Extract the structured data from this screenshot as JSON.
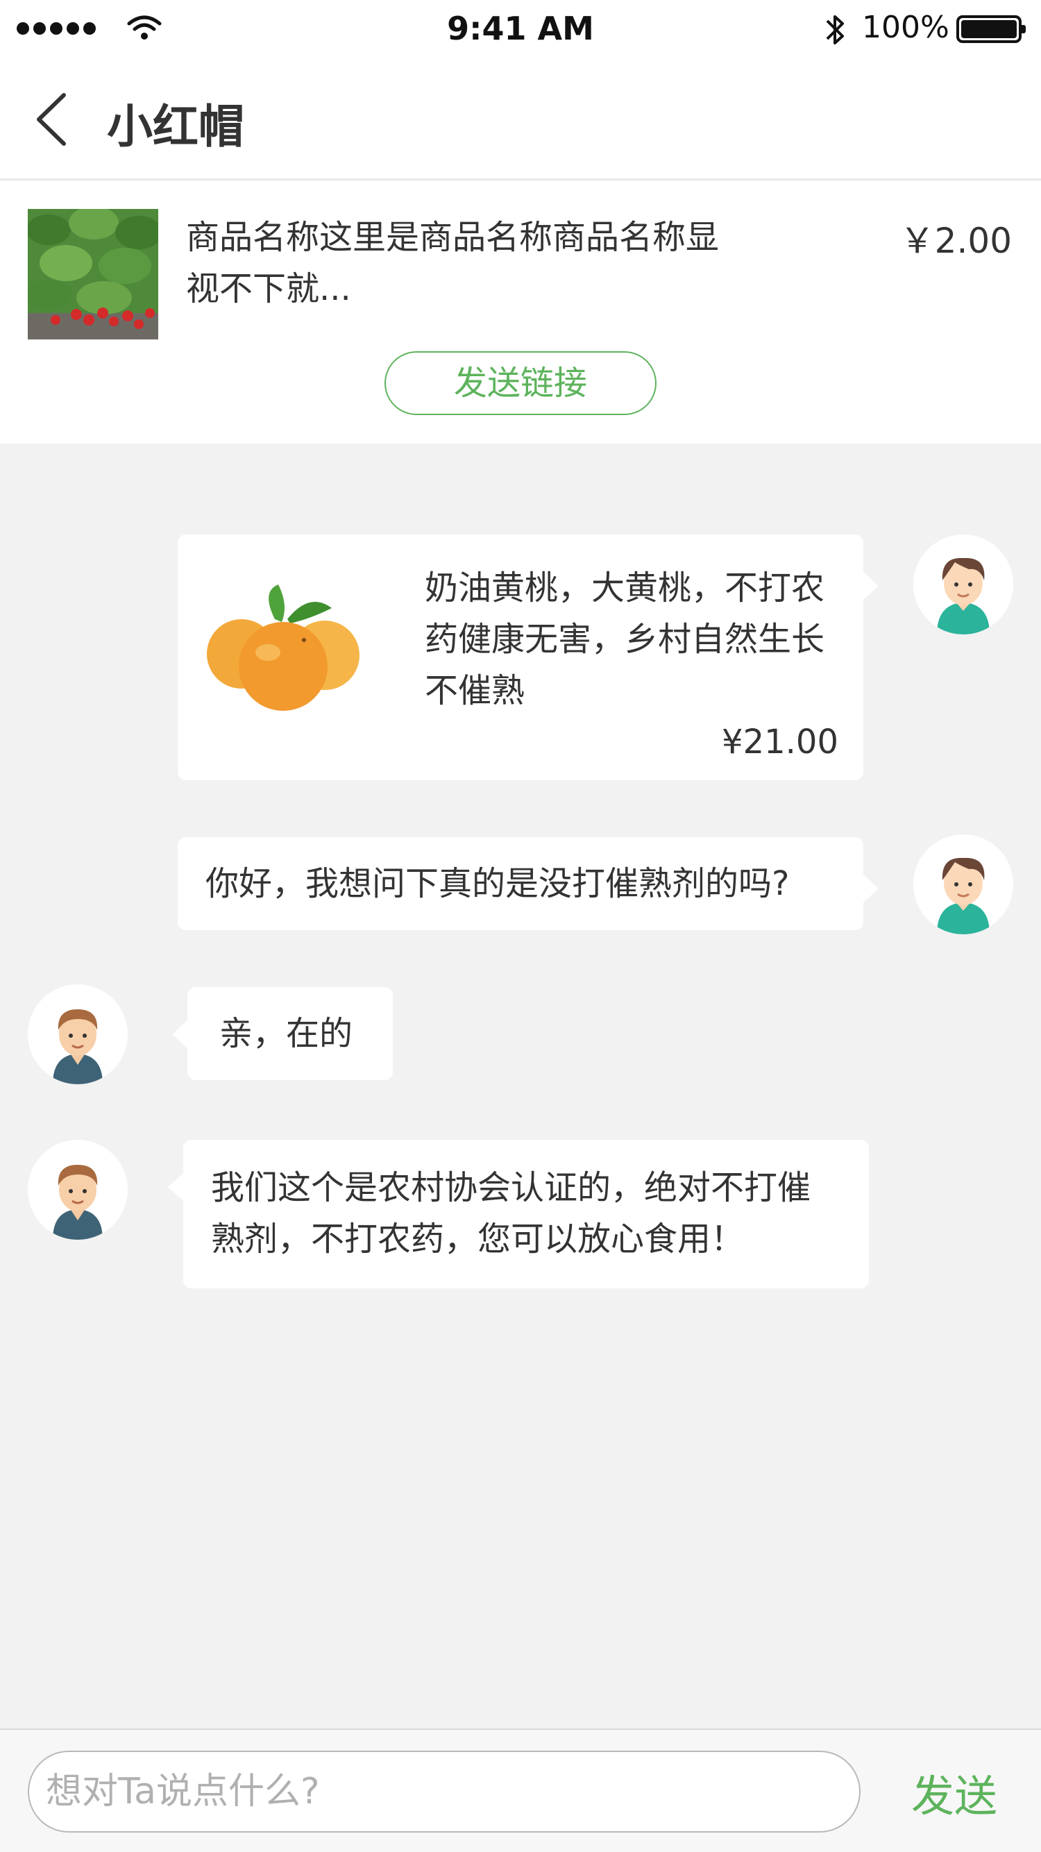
{
  "status_bar": {
    "time": "9:41 AM",
    "battery": "100%",
    "icons": [
      "signal-dots-icon",
      "wifi-icon",
      "bluetooth-icon",
      "battery-icon"
    ]
  },
  "nav": {
    "back_icon": "chevron-left-icon",
    "title": "小红帽"
  },
  "product": {
    "name": "商品名称这里是商品名称商品名称显视不下就...",
    "price": "￥2.00",
    "send_link_label": "发送链接"
  },
  "messages": [
    {
      "side": "right",
      "type": "product",
      "text": "奶油黄桃，大黄桃，不打农药健康无害，乡村自然生长不催熟",
      "price": "¥21.00"
    },
    {
      "side": "right",
      "type": "text",
      "text": "你好，我想问下真的是没打催熟剂的吗?"
    },
    {
      "side": "left",
      "type": "text",
      "text": "亲，在的"
    },
    {
      "side": "left",
      "type": "text",
      "text": "我们这个是农村协会认证的，绝对不打催熟剂，不打农药，您可以放心食用！"
    }
  ],
  "input": {
    "placeholder": "想对Ta说点什么?",
    "value": "",
    "send_label": "发送"
  },
  "colors": {
    "accent": "#5db35c",
    "background": "#f2f2f2",
    "text": "#333333"
  }
}
